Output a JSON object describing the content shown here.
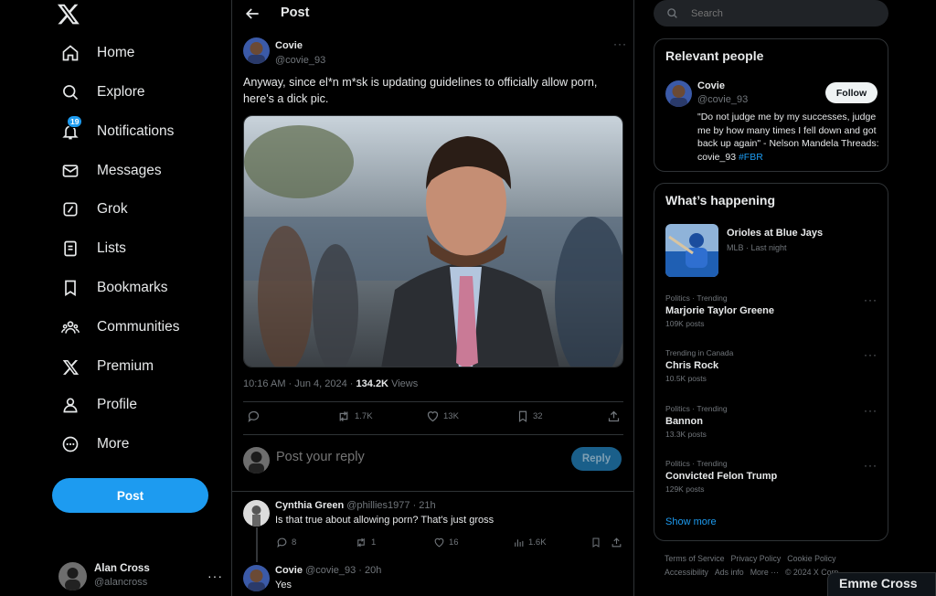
{
  "nav": {
    "items": [
      {
        "label": "Home",
        "icon": "home-icon"
      },
      {
        "label": "Explore",
        "icon": "search-icon"
      },
      {
        "label": "Notifications",
        "icon": "bell-icon",
        "badge": "19"
      },
      {
        "label": "Messages",
        "icon": "envelope-icon"
      },
      {
        "label": "Grok",
        "icon": "grok-icon"
      },
      {
        "label": "Lists",
        "icon": "list-icon"
      },
      {
        "label": "Bookmarks",
        "icon": "bookmark-icon"
      },
      {
        "label": "Communities",
        "icon": "communities-icon"
      },
      {
        "label": "Premium",
        "icon": "x-logo-icon"
      },
      {
        "label": "Profile",
        "icon": "person-icon"
      },
      {
        "label": "More",
        "icon": "more-circle-icon"
      }
    ],
    "post_button": "Post",
    "account": {
      "name": "Alan Cross",
      "handle": "@alancross",
      "more": "···"
    }
  },
  "header": {
    "title": "Post"
  },
  "post": {
    "author_name": "Covie",
    "author_handle": "@covie_93",
    "text": "Anyway, since el*n m*sk is updating guidelines to officially allow porn, here's a dick pic.",
    "time": "10:16 AM · Jun 4, 2024 · ",
    "views": "134.2K",
    "views_label": " Views",
    "replies": "",
    "reposts": "1.7K",
    "likes": "13K",
    "bookmarks": "32",
    "more": "···"
  },
  "reply_box": {
    "placeholder": "Post your reply",
    "button": "Reply"
  },
  "comments": [
    {
      "name": "Cynthia Green",
      "handle": "@phillies1977 · 21h",
      "text": "Is that true about allowing porn? That's just gross",
      "replies": "8",
      "reposts": "1",
      "likes": "16",
      "views": "1.6K"
    },
    {
      "name": "Covie",
      "handle": "@covie_93 · 20h",
      "text": "Yes"
    }
  ],
  "search": {
    "placeholder": "Search"
  },
  "relevant": {
    "title": "Relevant people",
    "name": "Covie",
    "handle": "@covie_93",
    "follow": "Follow",
    "bio": "\"Do not judge me by my successes, judge me by how many times I fell down and got back up again\" - Nelson Mandela Threads: covie_93 ",
    "bio_tag": "#FBR"
  },
  "happening": {
    "title": "What’s happening",
    "event": {
      "title": "Orioles at Blue Jays",
      "sub": "MLB · Last night"
    },
    "trends": [
      {
        "ctx": "Politics · Trending",
        "title": "Marjorie Taylor Greene",
        "count": "109K posts"
      },
      {
        "ctx": "Trending in Canada",
        "title": "Chris Rock",
        "count": "10.5K posts"
      },
      {
        "ctx": "Politics · Trending",
        "title": "Bannon",
        "count": "13.3K posts"
      },
      {
        "ctx": "Politics · Trending",
        "title": "Convicted Felon Trump",
        "count": "129K posts"
      }
    ],
    "show_more": "Show more"
  },
  "footer": {
    "links": [
      "Terms of Service",
      "Privacy Policy",
      "Cookie Policy",
      "Accessibility",
      "Ads info",
      "More ···",
      "© 2024 X Corp."
    ]
  },
  "toast": {
    "name": "Emme Cross"
  },
  "colors": {
    "accent": "#1d9bf0",
    "background": "#000000",
    "border": "#2f3336",
    "muted": "#71767b"
  }
}
